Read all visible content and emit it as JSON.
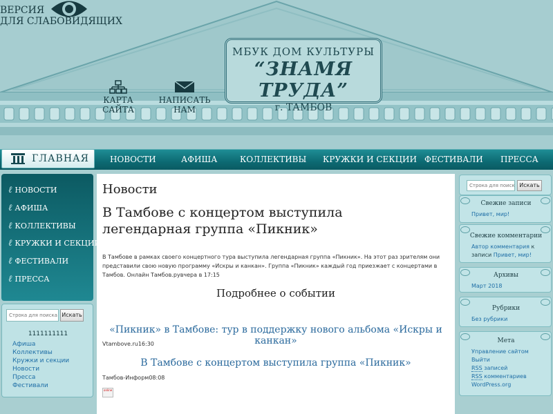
{
  "header": {
    "org_line1": "МБУК ДОМ КУЛЬТУРЫ",
    "org_name": "“ЗНАМЯ ТРУДА”",
    "org_city": "г. ТАМБОВ",
    "sitemap_label": "КАРТА САЙТА",
    "write_label": "НАПИСАТЬ НАМ",
    "vision_line1": "ВЕРСИЯ",
    "vision_line2": "ДЛЯ СЛАБОВИДЯЩИХ"
  },
  "nav": {
    "home": "ГЛАВНАЯ",
    "items": [
      "НОВОСТИ",
      "АФИША",
      "КОЛЛЕКТИВЫ",
      "КРУЖКИ И СЕКЦИИ",
      "ФЕСТИВАЛИ",
      "ПРЕССА"
    ]
  },
  "left_menu": {
    "items": [
      "НОВОСТИ",
      "АФИША",
      "КОЛЛЕКТИВЫ",
      "КРУЖКИ И СЕКЦИИ",
      "ФЕСТИВАЛИ",
      "ПРЕССА"
    ]
  },
  "left_box": {
    "search_placeholder": "Строка для поиска",
    "search_button": "Искать",
    "counter": "1111111111",
    "links": [
      "Афиша",
      "Коллективы",
      "Кружки и секции",
      "Новости",
      "Пресса",
      "Фестивали"
    ]
  },
  "main": {
    "page_title": "Новости",
    "article_title": "В Тамбове с концертом выступила легендарная группа «Пикник»",
    "article_body": "В Тамбове в рамках своего концертного тура выступила легендарная группа «Пикник». На этот раз зрителям они представили свою новую программу «Искры и канкан». Группа «Пикник» каждый год приезжает с концертами в Тамбов. Онлайн Тамбов.рувчера в 17:15",
    "more_link": "Подробнее о событии",
    "story1_title": "«Пикник» в Тамбове: тур в поддержку нового альбома «Искры и канкан»",
    "story1_source": "Vtambove.ru16:30",
    "story2_title": "В Тамбове с концертом выступила группа «Пикник»",
    "story2_source": "Тамбов-Информ08:08",
    "badge_text": "online"
  },
  "right": {
    "search_placeholder": "Строка для поиска",
    "search_button": "Искать",
    "recent_posts_title": "Свежие записи",
    "recent_posts": [
      "Привет, мир!"
    ],
    "recent_comments_title": "Свежие комментарии",
    "comment_author": "Автор комментария",
    "comment_on": "к",
    "comment_prefix": "записи",
    "comment_post": "Привет, мир!",
    "archives_title": "Архивы",
    "archives": [
      "Март 2018"
    ],
    "categories_title": "Рубрики",
    "categories": [
      "Без рубрики"
    ],
    "meta_title": "Мета",
    "meta_admin": "Управление сайтом",
    "meta_logout": "Выйти",
    "meta_rss_entries_abbr": "RSS",
    "meta_rss_entries_text": "записей",
    "meta_rss_comments_abbr": "RSS",
    "meta_rss_comments_text": "комментариев",
    "meta_wp": "WordPress.org"
  },
  "colors": {
    "background": "#a9cfd1",
    "nav_bar": "#0d6a73",
    "link": "#1e6ea6",
    "story_link": "#2b6a9d"
  }
}
